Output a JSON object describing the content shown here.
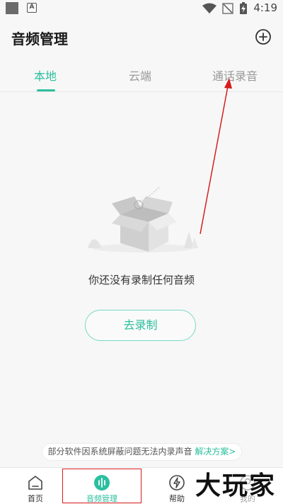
{
  "status_bar": {
    "time": "4:19",
    "badge_letter": "A",
    "icons": [
      "wifi-icon",
      "no-signal-icon",
      "battery-charging-icon"
    ]
  },
  "header": {
    "title": "音频管理",
    "add_icon": "plus-circle-icon"
  },
  "tabs": [
    {
      "label": "本地",
      "active": true
    },
    {
      "label": "云端",
      "active": false
    },
    {
      "label": "通话录音",
      "active": false
    }
  ],
  "empty_state": {
    "illustration": "empty-box-icon",
    "message": "你还没有录制任何音频",
    "button_label": "去录制"
  },
  "notice": {
    "text": "部分软件因系统屏蔽问题无法内录声音",
    "link": "解决方案>"
  },
  "bottom_nav": [
    {
      "label": "首页",
      "icon": "home-icon",
      "active": false
    },
    {
      "label": "音频管理",
      "icon": "audio-icon",
      "active": true
    },
    {
      "label": "帮助",
      "icon": "help-icon",
      "active": false
    },
    {
      "label": "我的",
      "icon": "user-icon",
      "active": false
    }
  ],
  "watermark": "大玩家",
  "colors": {
    "accent": "#2bbf9f",
    "annotation": "#d61c1c"
  }
}
